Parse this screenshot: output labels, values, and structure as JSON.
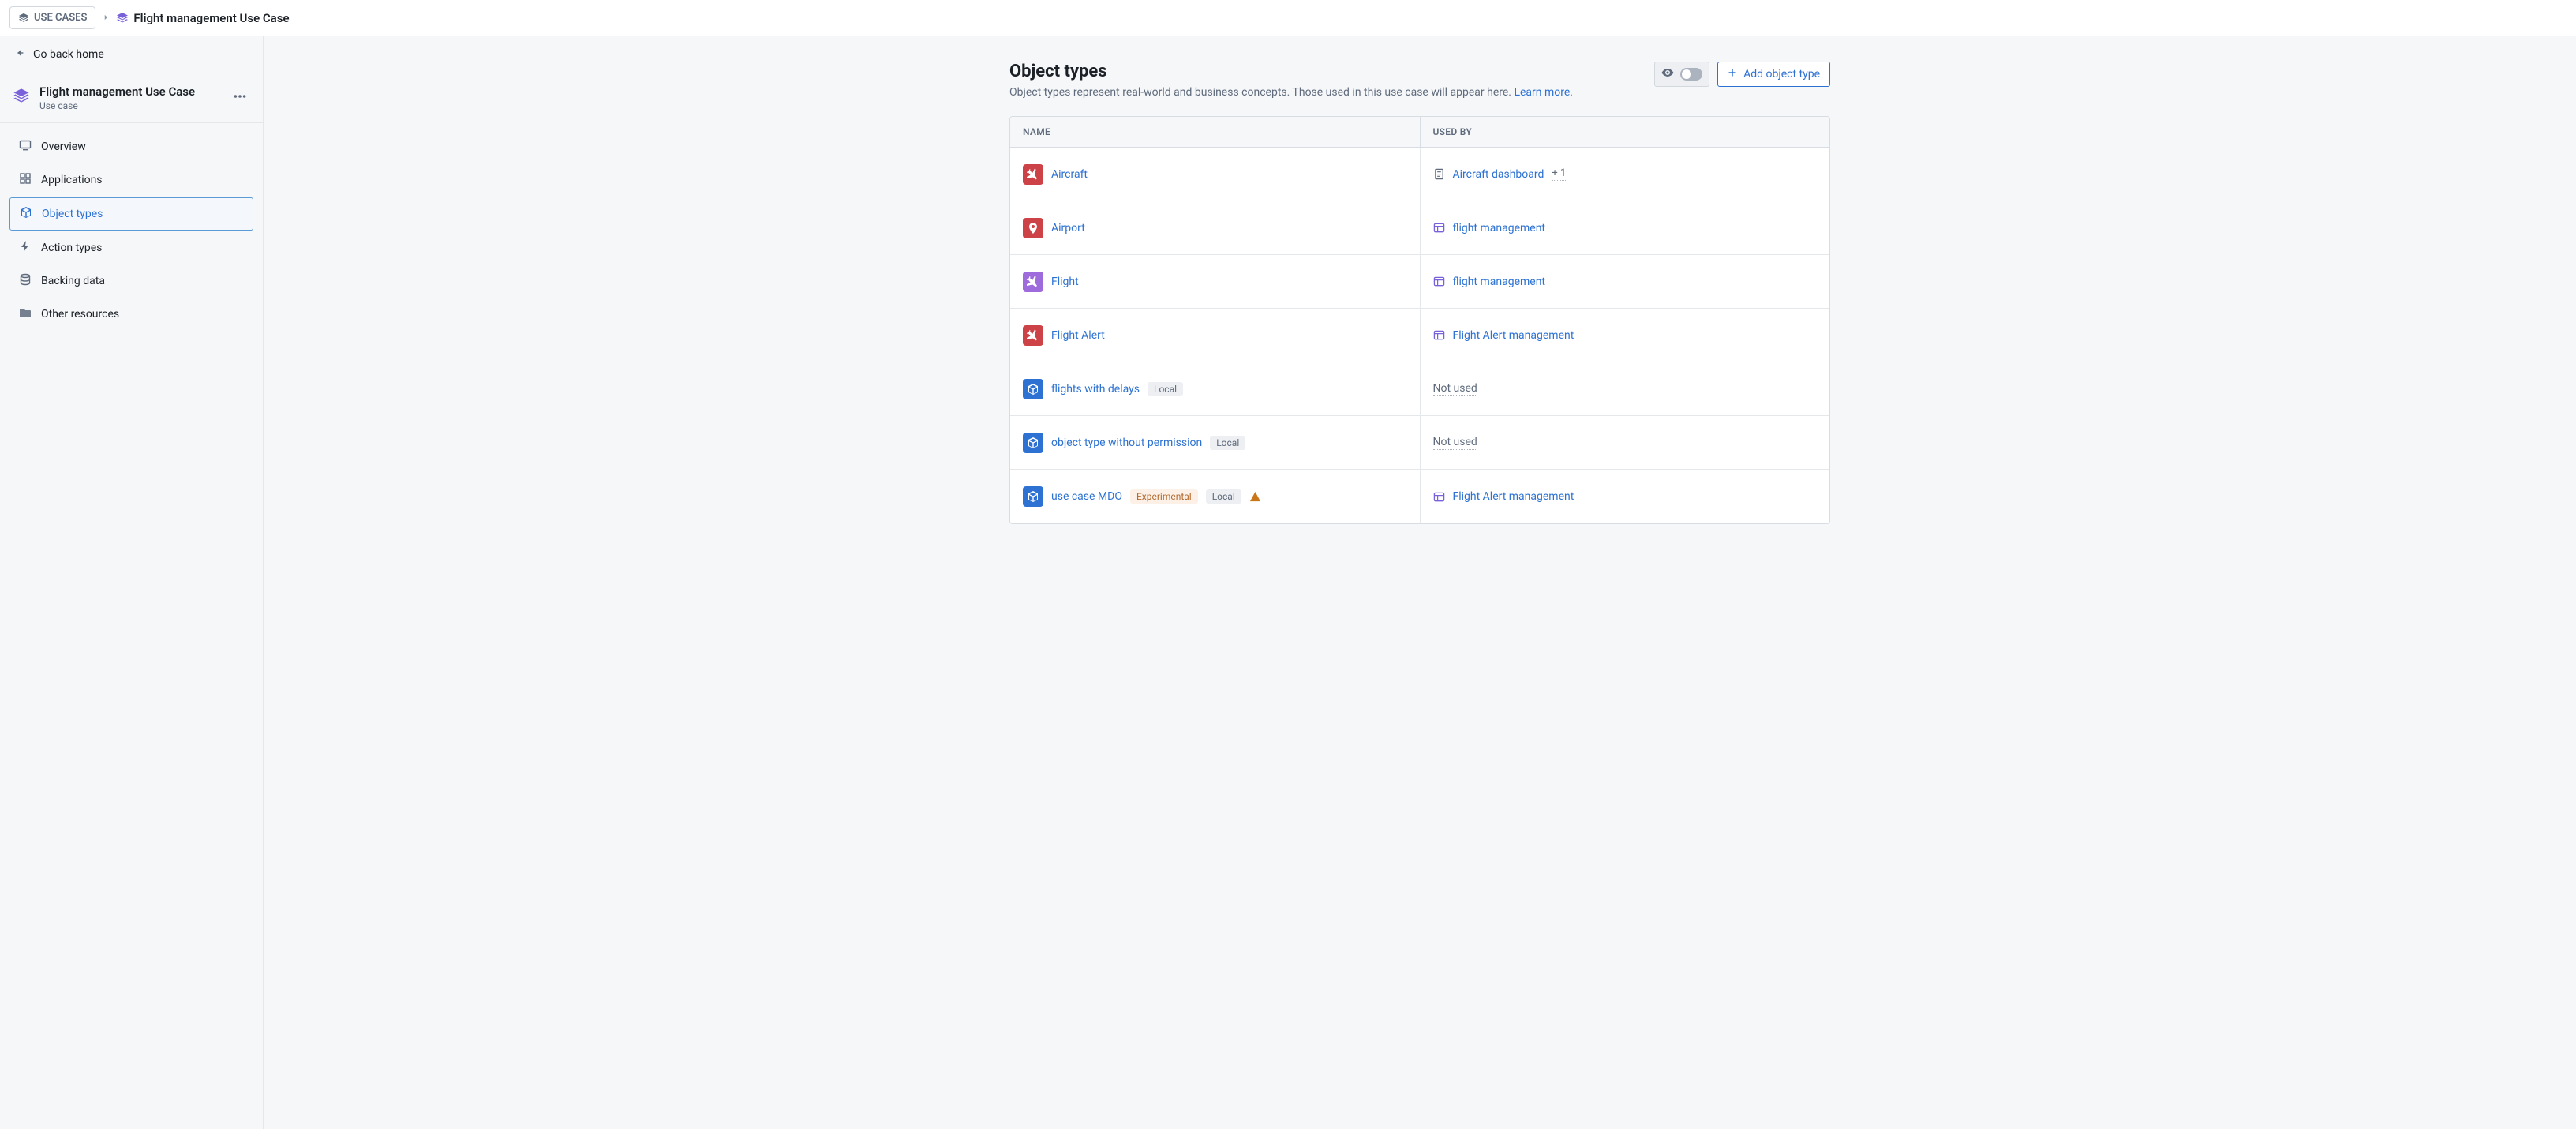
{
  "breadcrumb": {
    "root": "USE CASES",
    "current": "Flight management Use Case"
  },
  "sidebar": {
    "go_back": "Go back home",
    "title": "Flight management Use Case",
    "subtitle": "Use case",
    "nav": {
      "overview": "Overview",
      "applications": "Applications",
      "object_types": "Object types",
      "action_types": "Action types",
      "backing_data": "Backing data",
      "other_resources": "Other resources"
    }
  },
  "page": {
    "title": "Object types",
    "subtitle": "Object types represent real-world and business concepts. Those used in this use case will appear here. ",
    "learn_more": "Learn more",
    "add_button": "Add object type"
  },
  "table": {
    "col_name": "NAME",
    "col_used": "USED BY",
    "not_used": "Not used",
    "tags": {
      "local": "Local",
      "experimental": "Experimental"
    },
    "rows": [
      {
        "name": "Aircraft",
        "icon": "plane",
        "color": "red",
        "used_by": {
          "label": "Aircraft dashboard",
          "icon": "doc",
          "more": "+ 1"
        },
        "tags": []
      },
      {
        "name": "Airport",
        "icon": "pin",
        "color": "red",
        "used_by": {
          "label": "flight management",
          "icon": "app"
        },
        "tags": []
      },
      {
        "name": "Flight",
        "icon": "plane",
        "color": "purple",
        "used_by": {
          "label": "flight management",
          "icon": "app"
        },
        "tags": []
      },
      {
        "name": "Flight Alert",
        "icon": "plane",
        "color": "red",
        "used_by": {
          "label": "Flight Alert management",
          "icon": "app"
        },
        "tags": []
      },
      {
        "name": "flights with delays",
        "icon": "cube",
        "color": "blue",
        "used_by": null,
        "tags": [
          "local"
        ]
      },
      {
        "name": "object type without permission",
        "icon": "cube",
        "color": "blue",
        "used_by": null,
        "tags": [
          "local"
        ]
      },
      {
        "name": "use case MDO",
        "icon": "cube",
        "color": "blue",
        "used_by": {
          "label": "Flight Alert management",
          "icon": "app"
        },
        "tags": [
          "experimental",
          "local"
        ],
        "warn": true
      }
    ]
  }
}
